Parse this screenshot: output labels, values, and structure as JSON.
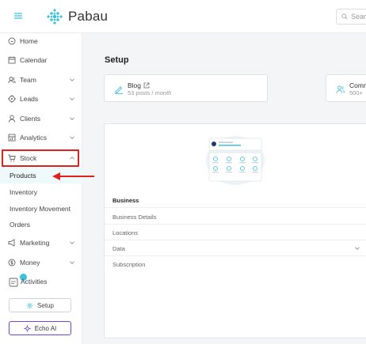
{
  "header": {
    "brand": "Pabau",
    "search_placeholder": "Sear"
  },
  "sidebar": {
    "items": [
      {
        "label": "Home",
        "icon": "home-icon"
      },
      {
        "label": "Calendar",
        "icon": "calendar-icon"
      },
      {
        "label": "Team",
        "icon": "team-icon"
      },
      {
        "label": "Leads",
        "icon": "leads-icon"
      },
      {
        "label": "Clients",
        "icon": "clients-icon"
      },
      {
        "label": "Analytics",
        "icon": "analytics-icon"
      },
      {
        "label": "Stock",
        "icon": "cart-icon"
      },
      {
        "label": "Marketing",
        "icon": "megaphone-icon"
      },
      {
        "label": "Money",
        "icon": "money-icon"
      },
      {
        "label": "Activities",
        "icon": "activities-icon"
      }
    ],
    "stock_sub": [
      "Products",
      "Inventory",
      "Inventory Movement",
      "Orders"
    ],
    "setup_button": "Setup",
    "echo_button": "Echo AI"
  },
  "main": {
    "title": "Setup",
    "cards": [
      {
        "title": "Blog",
        "subtitle": "53 posts / month",
        "icon": "pencil-icon"
      },
      {
        "title": "Comm",
        "subtitle": "500+",
        "icon": "community-icon"
      }
    ],
    "sections": [
      {
        "label": "Business",
        "heading": true
      },
      {
        "label": "Business Details"
      },
      {
        "label": "Locations"
      },
      {
        "label": "Data"
      },
      {
        "label": "Subscription"
      }
    ]
  },
  "colors": {
    "accent": "#3cc0dd",
    "highlight_box": "#e0201b",
    "echo_border": "#6a45d8"
  }
}
